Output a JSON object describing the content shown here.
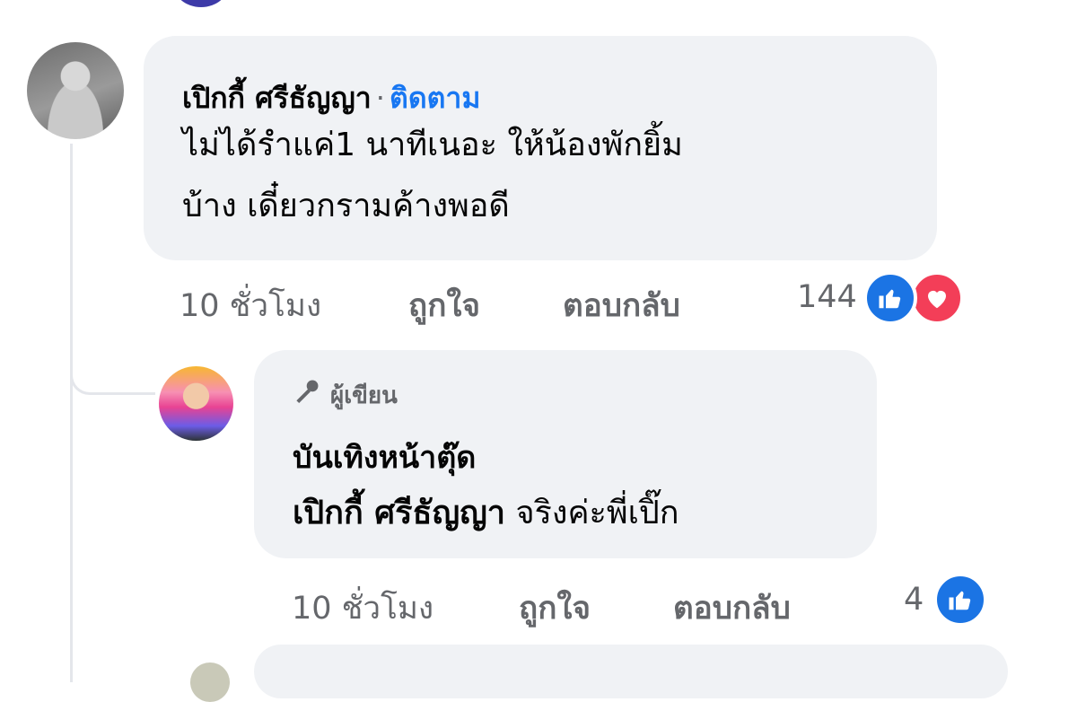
{
  "comment": {
    "author": "เปิกกี้ ศรีธัญญา",
    "separator": "·",
    "follow": "ติดตาม",
    "text_line1": "ไม่ได้รำแค่1 นาทีเนอะ ให้น้องพักยิ้ม",
    "text_line2": "บ้าง เดี๋ยวกรามค้างพอดี",
    "time": "10 ชั่วโมง",
    "like_action": "ถูกใจ",
    "reply_action": "ตอบกลับ",
    "reaction_count": "144",
    "reaction_icons": [
      "like-icon",
      "love-icon"
    ]
  },
  "reply": {
    "badge_icon": "microphone-icon",
    "badge": "ผู้เขียน",
    "author": "บันเทิงหน้าตุ๊ด",
    "mention": "เปิกกี้ ศรีธัญญา",
    "text": " จริงค่ะพี่เปิ๊ก",
    "time": "10 ชั่วโมง",
    "like_action": "ถูกใจ",
    "reply_action": "ตอบกลับ",
    "reaction_count": "4",
    "reaction_icons": [
      "like-icon"
    ]
  },
  "colors": {
    "link": "#1877f2",
    "bubble": "#f0f2f5",
    "meta": "#65676b",
    "like": "#1b74e4",
    "love": "#f33e58"
  }
}
